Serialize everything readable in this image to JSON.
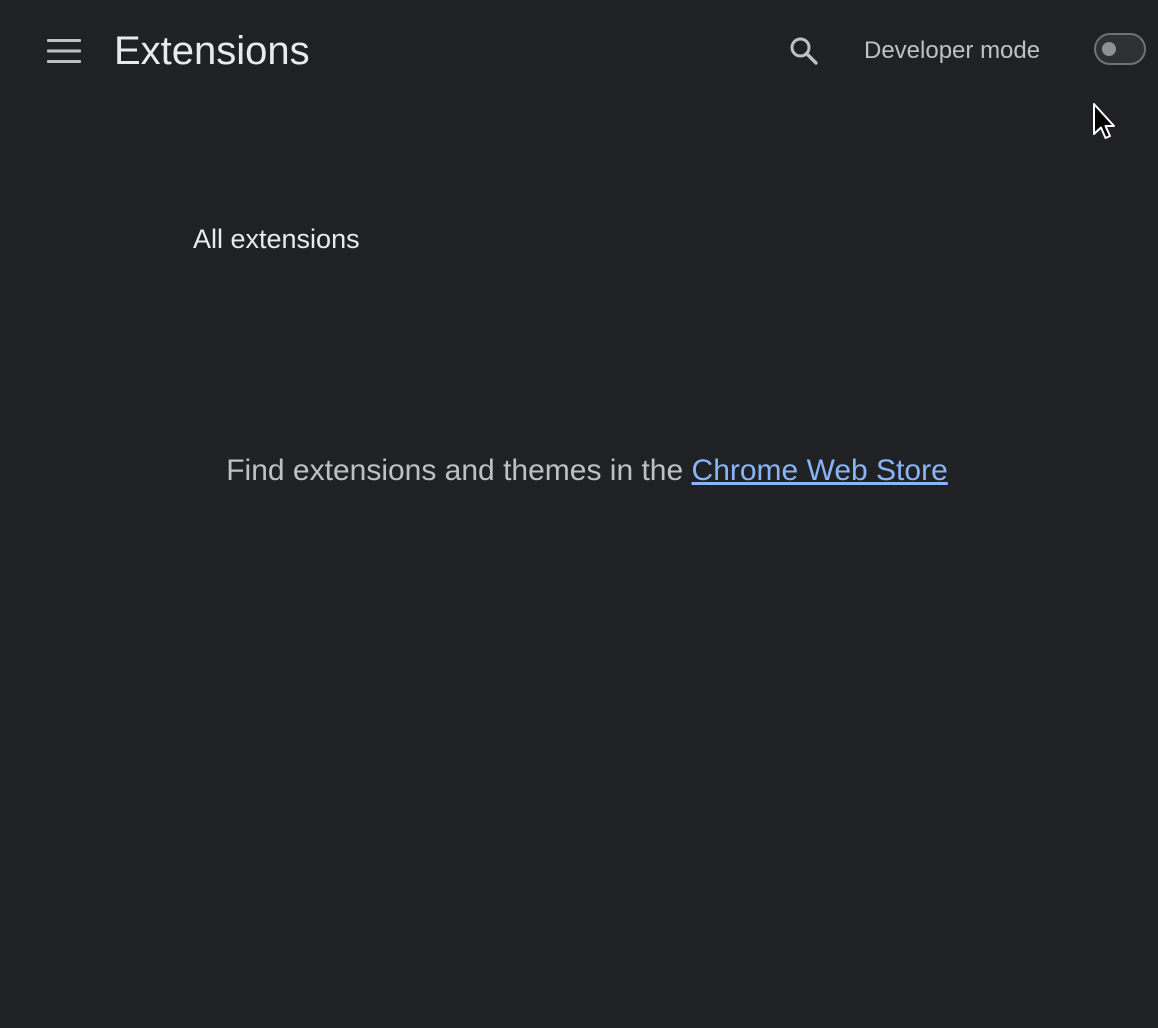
{
  "header": {
    "title": "Extensions",
    "menu_icon": "hamburger-menu-icon",
    "search_icon": "search-icon",
    "developer_mode_label": "Developer mode",
    "developer_mode_enabled": false
  },
  "main": {
    "section_title": "All extensions",
    "empty_message_prefix": "Find extensions and themes in the",
    "store_link_text": "Chrome Web Store"
  },
  "colors": {
    "background": "#202124",
    "text_primary": "#e8eaed",
    "text_secondary": "#bdc1c6",
    "link": "#8ab4f8"
  }
}
